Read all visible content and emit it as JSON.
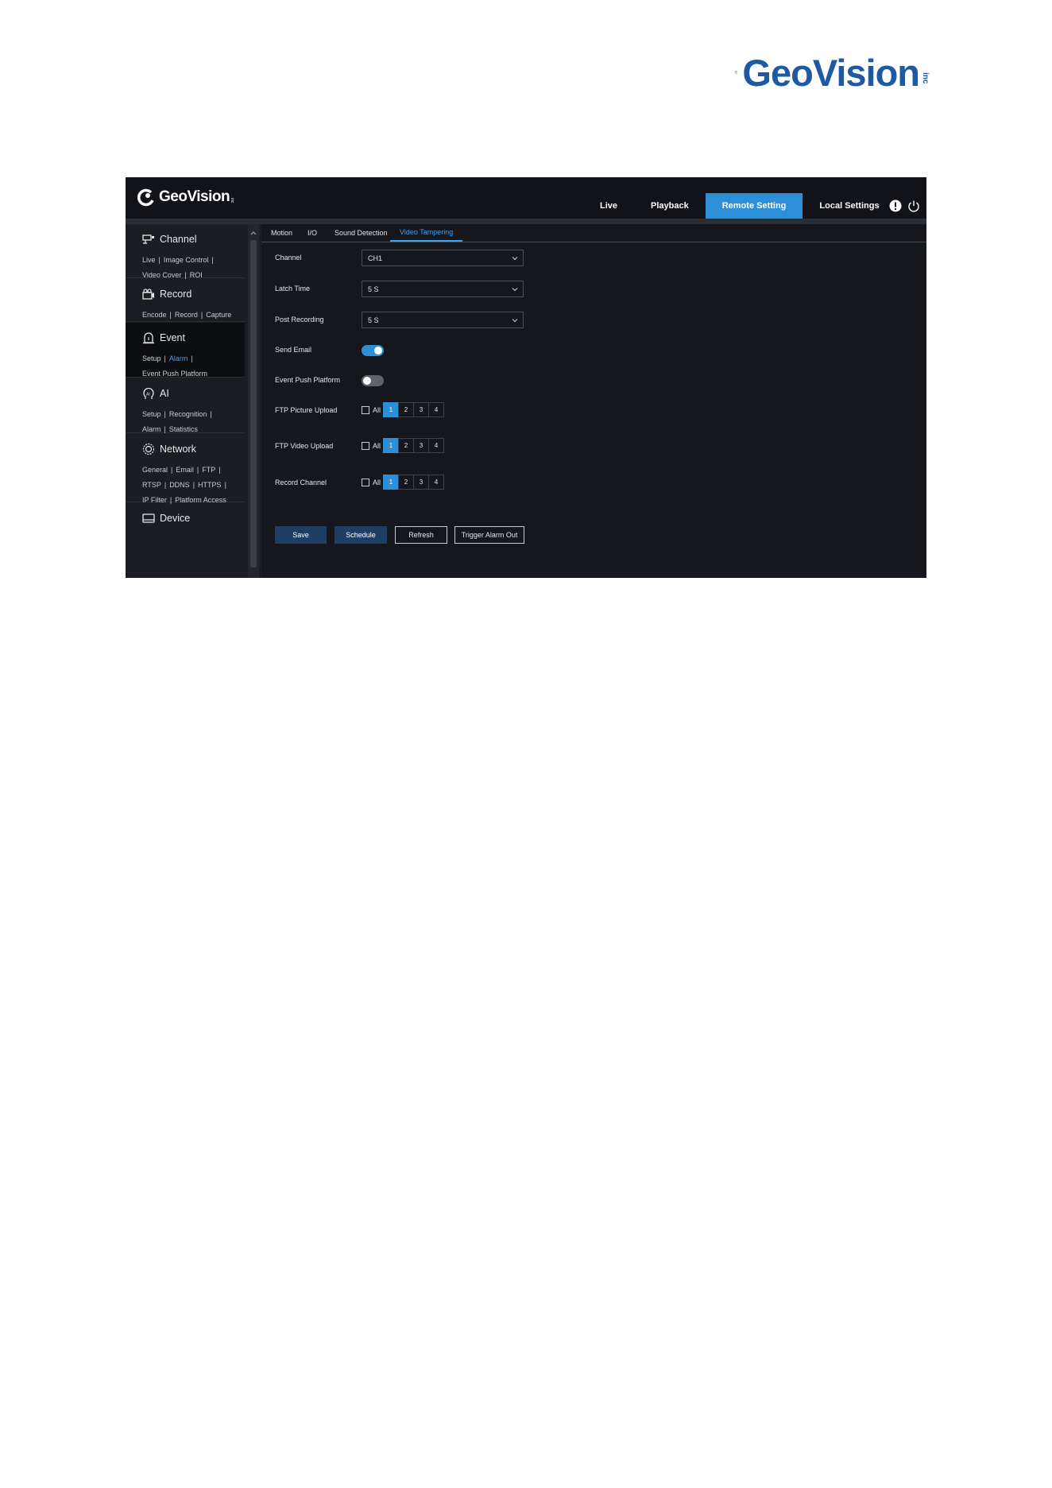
{
  "page_logo": {
    "text": "GeoVision",
    "inc": "inc"
  },
  "app": {
    "logo_text": "GeoVision",
    "logo_inc": "inc",
    "topnav": [
      {
        "label": "Live",
        "active": false
      },
      {
        "label": "Playback",
        "active": false
      },
      {
        "label": "Remote Setting",
        "active": true
      },
      {
        "label": "Local Settings",
        "active": false
      }
    ],
    "icons": [
      "info-icon",
      "power-icon"
    ],
    "accent_color": "#2d8fd8"
  },
  "sidebar": {
    "sections": [
      {
        "title": "Channel",
        "icon": "camera-icon",
        "links": [
          [
            "Live",
            "Image Control"
          ],
          [
            "Video Cover",
            "ROI"
          ]
        ]
      },
      {
        "title": "Record",
        "icon": "record-icon",
        "links": [
          [
            "Encode",
            "Record",
            "Capture"
          ]
        ]
      },
      {
        "title": "Event",
        "icon": "alarm-icon",
        "active": true,
        "links": [
          [
            "Setup",
            "Alarm"
          ],
          [
            "Event Push Platform"
          ]
        ],
        "active_link": "Alarm"
      },
      {
        "title": "AI",
        "icon": "ai-icon",
        "links": [
          [
            "Setup",
            "Recognition"
          ],
          [
            "Alarm",
            "Statistics"
          ]
        ]
      },
      {
        "title": "Network",
        "icon": "network-icon",
        "links": [
          [
            "General",
            "Email",
            "FTP"
          ],
          [
            "RTSP",
            "DDNS",
            "HTTPS"
          ],
          [
            "IP Filter",
            "Platform Access"
          ]
        ]
      },
      {
        "title": "Device",
        "icon": "device-icon",
        "links": []
      }
    ]
  },
  "tabs": [
    {
      "label": "Motion",
      "active": false
    },
    {
      "label": "I/O",
      "active": false
    },
    {
      "label": "Sound Detection",
      "active": false
    },
    {
      "label": "Video Tampering",
      "active": true
    }
  ],
  "form": {
    "channel": {
      "label": "Channel",
      "value": "CH1"
    },
    "latch_time": {
      "label": "Latch Time",
      "value": "5 S"
    },
    "post_recording": {
      "label": "Post Recording",
      "value": "5 S"
    },
    "send_email": {
      "label": "Send Email",
      "on": true
    },
    "event_push_platform": {
      "label": "Event Push Platform",
      "on": false
    },
    "ftp_picture_upload": {
      "label": "FTP Picture Upload",
      "all_label": "All",
      "all_checked": false,
      "channels": [
        "1",
        "2",
        "3",
        "4"
      ],
      "selected": [
        "1"
      ]
    },
    "ftp_video_upload": {
      "label": "FTP Video Upload",
      "all_label": "All",
      "all_checked": false,
      "channels": [
        "1",
        "2",
        "3",
        "4"
      ],
      "selected": [
        "1"
      ]
    },
    "record_channel": {
      "label": "Record Channel",
      "all_label": "All",
      "all_checked": false,
      "channels": [
        "1",
        "2",
        "3",
        "4"
      ],
      "selected": [
        "1"
      ]
    }
  },
  "buttons": {
    "save": "Save",
    "schedule": "Schedule",
    "refresh": "Refresh",
    "trigger_alarm_out": "Trigger Alarm Out"
  }
}
